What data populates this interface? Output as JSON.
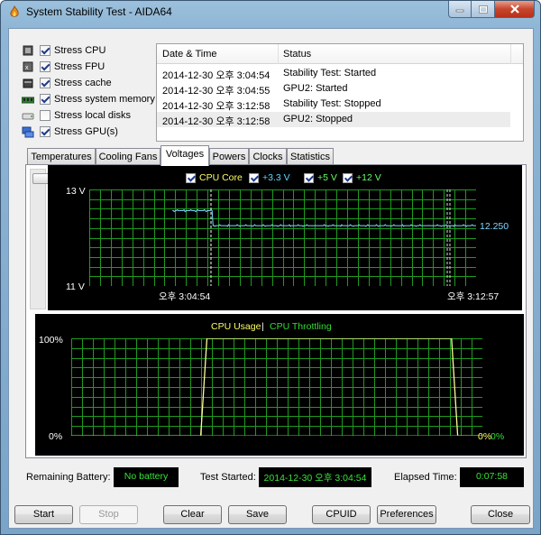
{
  "window": {
    "title": "System Stability Test - AIDA64"
  },
  "stress": [
    {
      "label": "Stress CPU",
      "checked": true,
      "icon": "cpu-icon"
    },
    {
      "label": "Stress FPU",
      "checked": true,
      "icon": "fpu-icon"
    },
    {
      "label": "Stress cache",
      "checked": true,
      "icon": "cache-icon"
    },
    {
      "label": "Stress system memory",
      "checked": true,
      "icon": "memory-icon"
    },
    {
      "label": "Stress local disks",
      "checked": false,
      "icon": "disk-icon"
    },
    {
      "label": "Stress GPU(s)",
      "checked": true,
      "icon": "gpu-icon"
    }
  ],
  "log": {
    "headers": [
      "Date & Time",
      "Status"
    ],
    "rows": [
      {
        "time": "2014-12-30 오후 3:04:54",
        "status": "Stability Test: Started"
      },
      {
        "time": "2014-12-30 오후 3:04:55",
        "status": "GPU2: Started"
      },
      {
        "time": "2014-12-30 오후 3:12:58",
        "status": "Stability Test: Stopped"
      },
      {
        "time": "2014-12-30 오후 3:12:58",
        "status": "GPU2: Stopped"
      }
    ]
  },
  "tabs": [
    "Temperatures",
    "Cooling Fans",
    "Voltages",
    "Powers",
    "Clocks",
    "Statistics"
  ],
  "active_tab": "Voltages",
  "voltage_graph": {
    "legend": [
      {
        "label": "CPU Core",
        "color": "#ffff66"
      },
      {
        "label": "+3.3 V",
        "color": "#5fd7ff"
      },
      {
        "label": "+5 V",
        "color": "#66ff66"
      },
      {
        "label": "+12 V",
        "color": "#66ff66"
      }
    ],
    "y_top": "13 V",
    "y_bottom": "11 V",
    "x_start": "오후 3:04:54",
    "x_end": "오후 3:12:57",
    "value_label": "12.250",
    "line_color": "#7fd8ff",
    "grid_color": "#1f9a1f"
  },
  "cpu_graph": {
    "title_usage": "CPU Usage",
    "title_sep": "|",
    "title_throttle": "CPU Throttling",
    "y_top": "100%",
    "y_bottom": "0%",
    "right_usage": "0%",
    "right_throttle": "0%",
    "usage_color": "#ffff99",
    "throttle_color": "#33dd33"
  },
  "status": {
    "battery_label": "Remaining Battery:",
    "battery_value": "No battery",
    "started_label": "Test Started:",
    "started_value": "2014-12-30 오후 3:04:54",
    "elapsed_label": "Elapsed Time:",
    "elapsed_value": "0:07:58"
  },
  "buttons": {
    "start": "Start",
    "stop": "Stop",
    "clear": "Clear",
    "save": "Save",
    "cpuid": "CPUID",
    "preferences": "Preferences",
    "close": "Close"
  },
  "chart_data": [
    {
      "type": "line",
      "title": "",
      "ylabel": "",
      "ylim": [
        11,
        13
      ],
      "x_range": [
        "오후 3:04:54",
        "오후 3:12:57"
      ],
      "series": [
        {
          "name": "+12 V",
          "note_value": 12.25,
          "x": [
            0,
            0.18,
            0.182,
            1.0
          ],
          "y": [
            12.56,
            12.56,
            12.25,
            12.25
          ]
        }
      ]
    },
    {
      "type": "line",
      "title": "",
      "ylim": [
        0,
        100
      ],
      "series": [
        {
          "name": "CPU Usage",
          "x": [
            0,
            0.315,
            0.33,
            0.925,
            0.94,
            1.0
          ],
          "y": [
            0,
            0,
            100,
            100,
            0,
            0
          ]
        },
        {
          "name": "CPU Throttling",
          "x": [
            0,
            1.0
          ],
          "y": [
            0,
            0
          ]
        }
      ]
    }
  ]
}
